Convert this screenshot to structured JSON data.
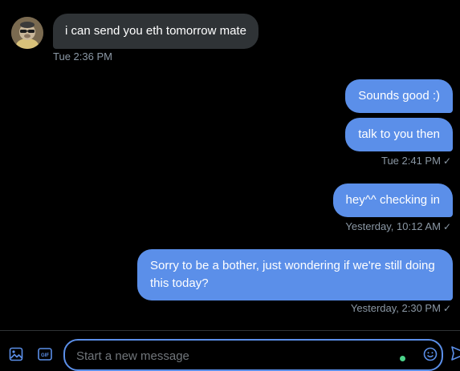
{
  "colors": {
    "background": "#000000",
    "incoming_bubble": "#2f3336",
    "outgoing_bubble": "#5b8fe9",
    "meta_text": "#8b98a5",
    "accent": "#5b8fe9"
  },
  "messages": [
    {
      "direction": "incoming",
      "text": "i can send you eth tomorrow mate"
    },
    {
      "direction": "outgoing",
      "text": "Sounds good :)"
    },
    {
      "direction": "outgoing",
      "text": "talk to you then"
    },
    {
      "direction": "outgoing",
      "text": "hey^^ checking in"
    },
    {
      "direction": "outgoing",
      "text": "Sorry to be a bother, just wondering if we're still doing this today?"
    }
  ],
  "timestamps": [
    {
      "text": "Tue 2:36 PM"
    },
    {
      "text": "Tue 2:41 PM"
    },
    {
      "text": "Yesterday, 10:12 AM"
    },
    {
      "text": "Yesterday, 2:30 PM"
    }
  ],
  "composer": {
    "placeholder": "Start a new message",
    "icons": [
      "image-icon",
      "gif-icon",
      "emoji-icon",
      "send-icon"
    ]
  }
}
